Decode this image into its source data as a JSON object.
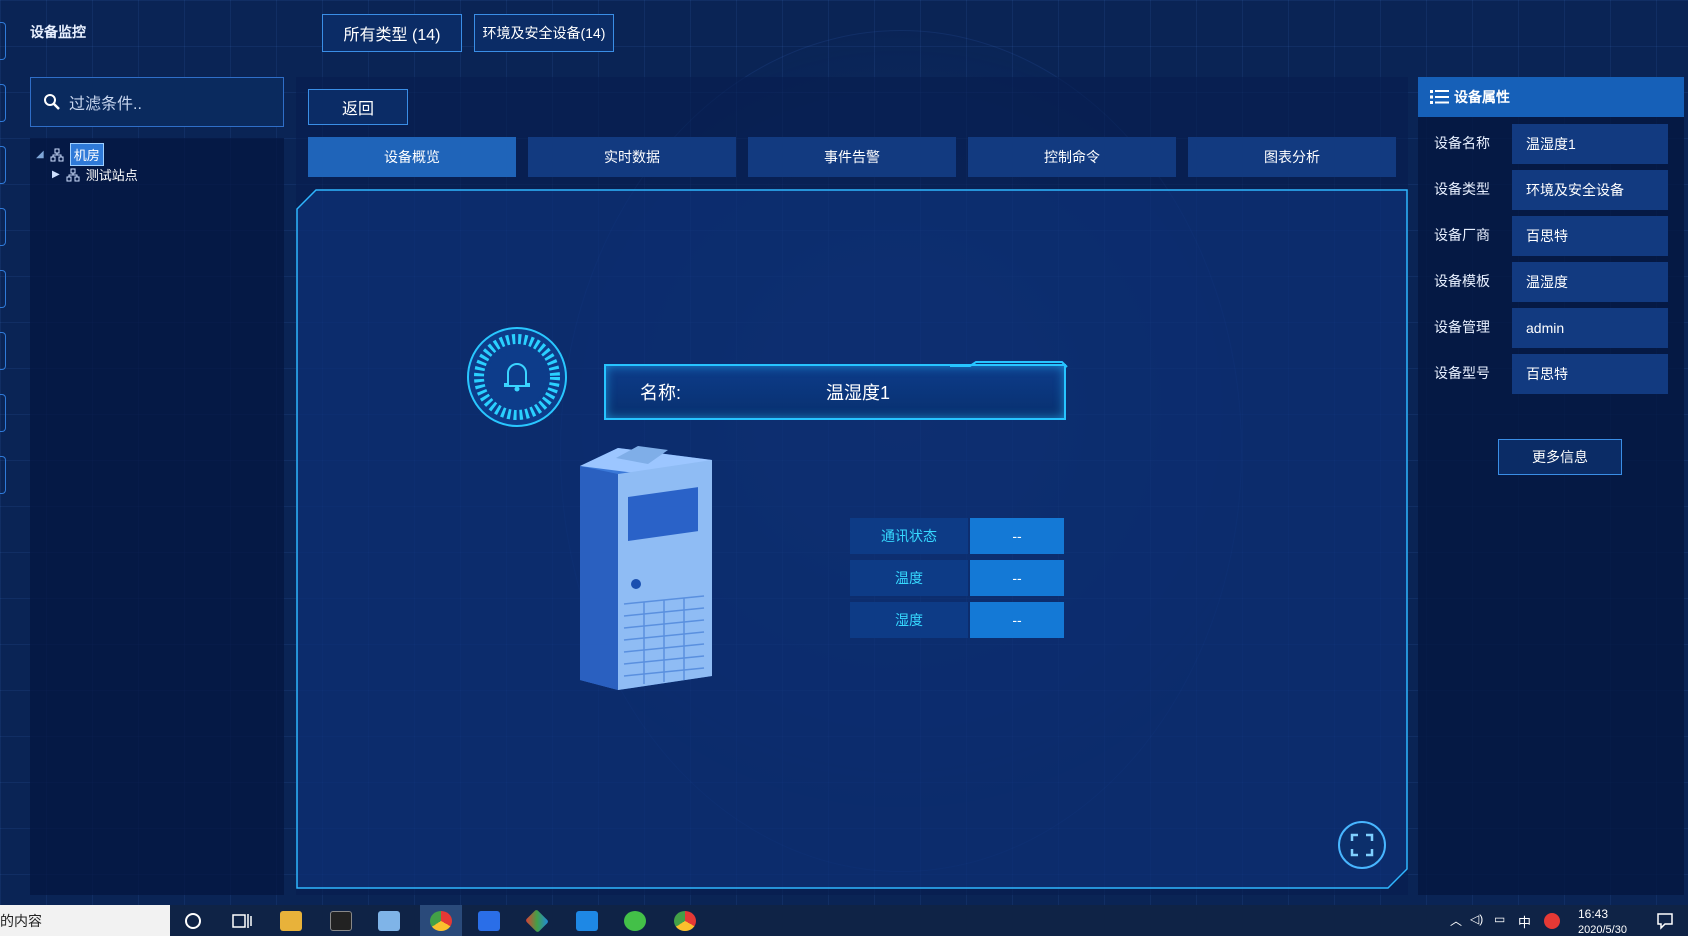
{
  "topbar": {
    "title": "设备监控",
    "type_buttons": [
      "所有类型 (14)",
      "环境及安全设备(14)"
    ]
  },
  "sidebar": {
    "filter_placeholder": "过滤条件..",
    "tree": [
      {
        "label": "机房",
        "selected": true
      },
      {
        "label": "测试站点",
        "selected": false
      }
    ]
  },
  "main": {
    "back_label": "返回",
    "tabs": [
      {
        "label": "设备概览",
        "active": true
      },
      {
        "label": "实时数据",
        "active": false
      },
      {
        "label": "事件告警",
        "active": false
      },
      {
        "label": "控制命令",
        "active": false
      },
      {
        "label": "图表分析",
        "active": false
      }
    ],
    "name_label": "名称:",
    "name_value": "温湿度1",
    "metrics": [
      {
        "key": "通讯状态",
        "value": "--"
      },
      {
        "key": "温度",
        "value": "--"
      },
      {
        "key": "湿度",
        "value": "--"
      }
    ]
  },
  "properties": {
    "header": "设备属性",
    "rows": [
      {
        "key": "设备名称",
        "value": "温湿度1"
      },
      {
        "key": "设备类型",
        "value": "环境及安全设备"
      },
      {
        "key": "设备厂商",
        "value": "百思特"
      },
      {
        "key": "设备模板",
        "value": "温湿度"
      },
      {
        "key": "设备管理",
        "value": "admin"
      },
      {
        "key": "设备型号",
        "value": "百思特"
      }
    ],
    "more_label": "更多信息"
  },
  "taskbar": {
    "search_text": "的内容",
    "ime": "中",
    "time": "16:43",
    "date": "2020/5/30"
  },
  "colors": {
    "accent": "#27c4ff",
    "panel": "#0a2455",
    "tab_active": "#1f64b9",
    "tab_idle": "#123a80"
  }
}
